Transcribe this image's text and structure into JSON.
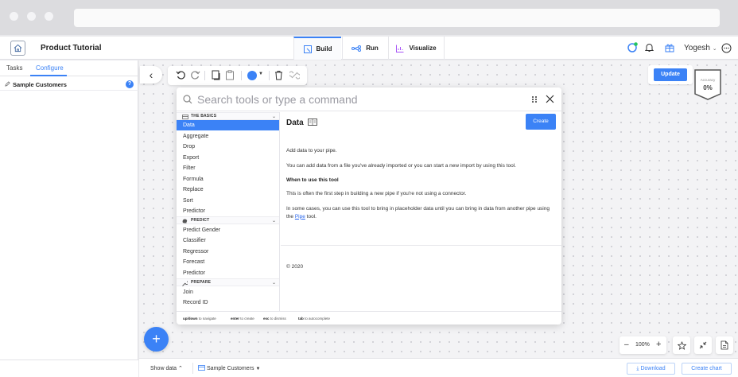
{
  "header": {
    "title": "Product Tutorial",
    "tabs": [
      {
        "label": "Build",
        "active": true
      },
      {
        "label": "Run",
        "active": false
      },
      {
        "label": "Visualize",
        "active": false
      }
    ],
    "user_name": "Yogesh",
    "accent_color": "#3b82f6"
  },
  "sidebar": {
    "tabs": [
      {
        "label": "Tasks",
        "active": false
      },
      {
        "label": "Configure",
        "active": true
      }
    ],
    "current_item": "Sample Customers",
    "help_icon": "?"
  },
  "canvas": {
    "update_label": "Update",
    "accuracy_label": "Accuracy",
    "accuracy_value": "0%",
    "zoom_level": "100%"
  },
  "palette": {
    "search_placeholder": "Search tools or type a command",
    "sections": [
      {
        "name": "THE BASICS",
        "items": [
          "Data",
          "Aggregate",
          "Drop",
          "Export",
          "Filter",
          "Formula",
          "Replace",
          "Sort",
          "Predictor"
        ]
      },
      {
        "name": "PREDICT",
        "items": [
          "Predict Gender",
          "Classifier",
          "Regressor",
          "Forecast",
          "Predictor"
        ]
      },
      {
        "name": "PREPARE",
        "items": [
          "Join",
          "Record ID"
        ]
      }
    ],
    "selected_item": "Data",
    "detail": {
      "title": "Data",
      "create_label": "Create",
      "p1": "Add data to your pipe.",
      "p2": "You can add data from a file you've already imported or you can start a new import by using this tool.",
      "heading": "When to use this tool",
      "p3": "This is often the first step in building a new pipe if you're not using a connector.",
      "p4a": "In some cases, you can use this tool to bring in placeholder data until you can bring in data from another pipe using the ",
      "p4link": "Pipe",
      "p4b": " tool.",
      "copyright": "© 2020"
    },
    "footer": [
      {
        "key": "up/down",
        "text": "to navigate"
      },
      {
        "key": "enter",
        "text": "to create"
      },
      {
        "key": "esc",
        "text": "to dismiss"
      },
      {
        "key": "tab",
        "text": "to autocomplete"
      }
    ]
  },
  "bottom": {
    "show_data_label": "Show data",
    "dataset_label": "Sample Customers",
    "download_label": "Download",
    "create_chart_label": "Create chart"
  }
}
